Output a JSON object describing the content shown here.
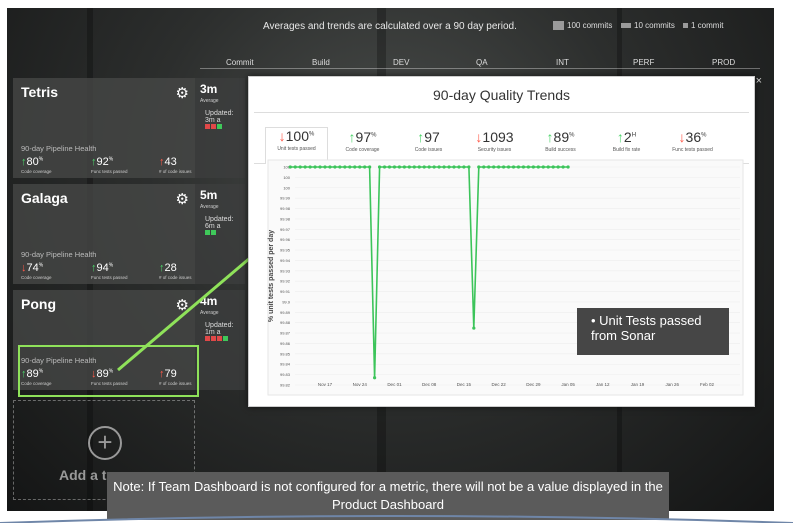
{
  "header": {
    "note": "Averages and trends are calculated over a 90 day period.",
    "legend": [
      "100 commits",
      "10 commits",
      "1 commit"
    ]
  },
  "columns": [
    "Commit",
    "Build",
    "DEV",
    "QA",
    "INT",
    "PERF",
    "PROD"
  ],
  "teams": [
    {
      "name": "Tetris",
      "health_label": "90-day Pipeline Health",
      "metrics": [
        {
          "dir": "up",
          "value": "80",
          "unit": "%",
          "label": "Code coverage"
        },
        {
          "dir": "up",
          "value": "92",
          "unit": "%",
          "label": "Func tests passed"
        },
        {
          "dir": "up",
          "value": "43",
          "unit": "",
          "label": "# of code issues"
        }
      ],
      "commit_time": "3m",
      "commit_avg": "Average",
      "updated": "Updated: 3m a",
      "bar_colors": [
        "#e04848",
        "#e04848",
        "#3fc85a"
      ]
    },
    {
      "name": "Galaga",
      "health_label": "90-day Pipeline Health",
      "metrics": [
        {
          "dir": "down",
          "value": "74",
          "unit": "%",
          "label": "Code coverage"
        },
        {
          "dir": "up",
          "value": "94",
          "unit": "%",
          "label": "Func tests passed"
        },
        {
          "dir": "up",
          "value": "28",
          "unit": "",
          "label": "# of code issues"
        }
      ],
      "commit_time": "5m",
      "commit_avg": "Average",
      "updated": "Updated: 6m a",
      "bar_colors": [
        "#3fc85a",
        "#3fc85a"
      ]
    },
    {
      "name": "Pong",
      "health_label": "90-day Pipeline Health",
      "metrics": [
        {
          "dir": "up",
          "value": "89",
          "unit": "%",
          "label": "Code coverage"
        },
        {
          "dir": "down",
          "value": "89",
          "unit": "%",
          "label": "Func tests passed"
        },
        {
          "dir": "up",
          "value": "79",
          "unit": "",
          "label": "# of code issues"
        }
      ],
      "commit_time": "4m",
      "commit_avg": "Average",
      "updated": "Updated: 1m a",
      "bar_colors": [
        "#e04848",
        "#e04848",
        "#e04848",
        "#3fc85a"
      ]
    }
  ],
  "add_team": {
    "icon": "plus-icon",
    "label": "Add a team"
  },
  "popup": {
    "title": "90-day Quality Trends",
    "tabs": [
      {
        "dir": "down",
        "value": "100",
        "unit": "%",
        "label": "Unit tests passed",
        "active": true
      },
      {
        "dir": "up",
        "value": "97",
        "unit": "%",
        "label": "Code coverage"
      },
      {
        "dir": "up",
        "value": "97",
        "unit": "",
        "label": "Code issues"
      },
      {
        "dir": "down",
        "value": "1093",
        "unit": "",
        "label": "Security issues"
      },
      {
        "dir": "up",
        "value": "89",
        "unit": "%",
        "label": "Build success"
      },
      {
        "dir": "up",
        "value": "2",
        "unit": "H",
        "label": "Build fix rate"
      },
      {
        "dir": "down",
        "value": "36",
        "unit": "%",
        "label": "Func tests passed"
      }
    ]
  },
  "chart_data": {
    "type": "line",
    "ylabel": "% unit tests passed per day",
    "yticks": [
      "100",
      "100",
      "100",
      "99.99",
      "99.98",
      "99.98",
      "99.97",
      "99.96",
      "99.95",
      "99.94",
      "99.93",
      "99.92",
      "99.91",
      "99.9",
      "99.89",
      "99.88",
      "99.87",
      "99.86",
      "99.85",
      "99.84",
      "99.83",
      "99.82"
    ],
    "xticks": [
      "Nov 17",
      "Nov 24",
      "Dec 01",
      "Dec 08",
      "Dec 15",
      "Dec 22",
      "Dec 29",
      "Jan 05",
      "Jan 12",
      "Jan 19",
      "Jan 26",
      "Feb 02"
    ],
    "ylim": [
      99.82,
      100
    ],
    "series": [
      {
        "color": "#3cc45a",
        "x": [
          "Nov 10",
          "Nov 11",
          "Nov 12",
          "Nov 13",
          "Nov 14",
          "Nov 15",
          "Nov 16",
          "Nov 17",
          "Nov 18",
          "Nov 19",
          "Nov 20",
          "Nov 21",
          "Nov 22",
          "Nov 23",
          "Nov 24",
          "Nov 25",
          "Nov 26",
          "Nov 27",
          "Nov 28",
          "Nov 29",
          "Nov 30",
          "Dec 01",
          "Dec 02",
          "Dec 03",
          "Dec 04",
          "Dec 05",
          "Dec 06",
          "Dec 07",
          "Dec 08",
          "Dec 09",
          "Dec 10",
          "Dec 11",
          "Dec 12",
          "Dec 13",
          "Dec 14",
          "Dec 15",
          "Dec 16",
          "Dec 17",
          "Dec 18",
          "Dec 19",
          "Dec 20",
          "Dec 21",
          "Dec 22",
          "Dec 23",
          "Dec 24",
          "Dec 25",
          "Dec 26",
          "Dec 27",
          "Dec 28",
          "Dec 29",
          "Dec 30",
          "Dec 31",
          "Jan 01",
          "Jan 02",
          "Jan 03",
          "Jan 04",
          "Jan 05"
        ],
        "y": [
          100,
          100,
          100,
          100,
          100,
          100,
          100,
          100,
          100,
          100,
          100,
          100,
          100,
          100,
          100,
          100,
          100,
          99.826,
          100,
          100,
          100,
          100,
          100,
          100,
          100,
          100,
          100,
          100,
          100,
          100,
          100,
          100,
          100,
          100,
          100,
          100,
          100,
          99.867,
          100,
          100,
          100,
          100,
          100,
          100,
          100,
          100,
          100,
          100,
          100,
          100,
          100,
          100,
          100,
          100,
          100,
          100,
          100
        ]
      }
    ]
  },
  "callout": {
    "text": "Unit Tests passed from Sonar"
  },
  "note": {
    "line1": "Note: If Team Dashboard is not configured for a metric, there will not be a value",
    "line2": "displayed in the Product Dashboard"
  }
}
